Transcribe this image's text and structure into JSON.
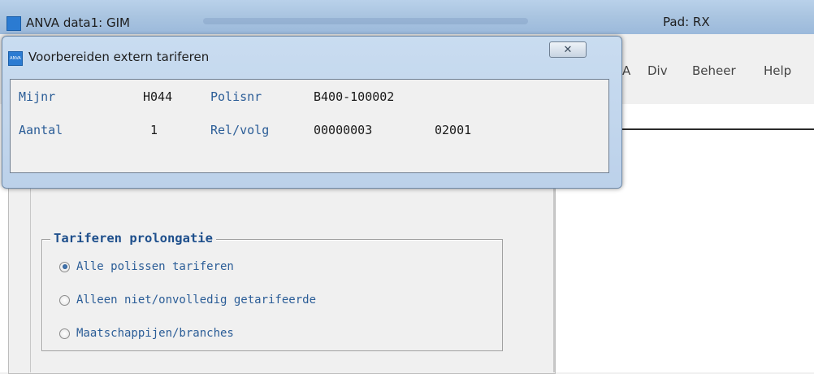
{
  "main_window": {
    "title": "ANVA data1: GIM",
    "pad_label": "Pad: RX"
  },
  "menubar": {
    "items": [
      "A",
      "Div",
      "Beheer",
      "Help"
    ]
  },
  "dialog": {
    "title": "Voorbereiden extern tariferen",
    "close_glyph": "✕",
    "fields": {
      "mijnr_label": "Mijnr",
      "mijnr_value": "H044",
      "polisnr_label": "Polisnr",
      "polisnr_value": "B400-100002",
      "aantal_label": "Aantal",
      "aantal_value": "1",
      "relvolg_label": "Rel/volg",
      "relvolg_value": "00000003",
      "relvolg_extra": "02001"
    }
  },
  "prolongatie": {
    "title": "Tariferen prolongatie",
    "options": [
      {
        "label": "Alle polissen tariferen",
        "checked": true
      },
      {
        "label": "Alleen niet/onvolledig getarifeerde",
        "checked": false
      },
      {
        "label": "Maatschappijen/branches",
        "checked": false
      }
    ]
  }
}
